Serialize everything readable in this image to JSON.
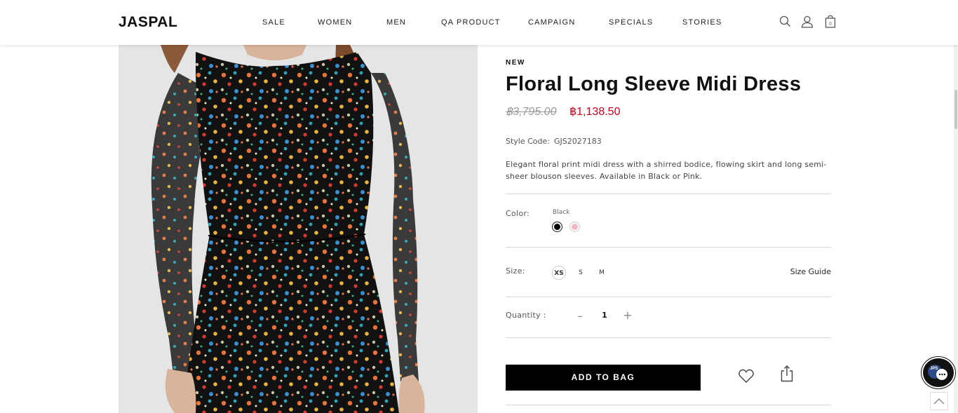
{
  "brand": {
    "logo": "JASPAL"
  },
  "nav": {
    "items": [
      {
        "label": "SALE"
      },
      {
        "label": "WOMEN"
      },
      {
        "label": "MEN"
      },
      {
        "label": "QA PRODUCT"
      },
      {
        "label": "CAMPAIGN"
      },
      {
        "label": "SPECIALS"
      },
      {
        "label": "STORIES"
      }
    ]
  },
  "header_icons": [
    "search-icon",
    "user-icon",
    "shopping-bag-icon"
  ],
  "header_bag_count": "0",
  "product": {
    "tag": "NEW",
    "title": "Floral Long Sleeve Midi Dress",
    "price_original": "฿3,795.00",
    "price_sale": "฿1,138.50",
    "style_code_label": "Style Code:",
    "style_code": "GJS2027183",
    "description": "Elegant floral print midi dress with a shirred bodice, flowing skirt and long semi-sheer blouson sleeves. Available in Black or Pink.",
    "color_label": "Color:",
    "color_selected": "Black",
    "colors": [
      {
        "name": "Black",
        "hex": "#000000"
      },
      {
        "name": "Pink",
        "hex": "#f3b8c0"
      }
    ],
    "size_label": "Size:",
    "sizes": [
      "XS",
      "S",
      "M"
    ],
    "size_selected": "XS",
    "size_guide": "Size Guide",
    "quantity_label": "Quantity :",
    "quantity": "1",
    "qty_minus": "–",
    "qty_plus": "+",
    "add_to_bag": "ADD TO BAG"
  },
  "chat_widget": {
    "label": "JPS"
  },
  "colors": {
    "sale_price": "#d0021b",
    "button_bg": "#000000",
    "button_text": "#ffffff"
  }
}
